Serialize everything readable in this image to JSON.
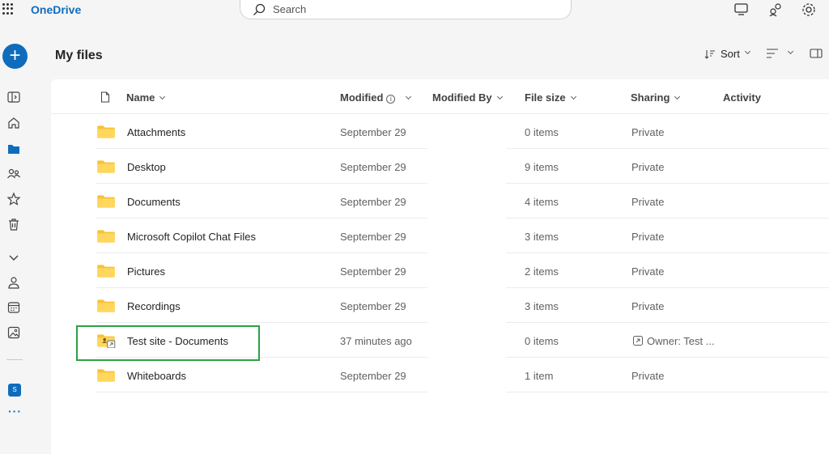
{
  "app": {
    "name": "OneDrive"
  },
  "search": {
    "placeholder": "Search"
  },
  "page": {
    "title": "My files"
  },
  "toolbar": {
    "sort_label": "Sort"
  },
  "new_button": {
    "label": "+"
  },
  "rail": {
    "site_badge": "S",
    "more": "···"
  },
  "columns": {
    "name": "Name",
    "modified": "Modified",
    "modified_info": "i",
    "modified_by": "Modified By",
    "file_size": "File size",
    "sharing": "Sharing",
    "activity": "Activity"
  },
  "files": [
    {
      "name": "Attachments",
      "modified": "September 29",
      "size": "0 items",
      "sharing": "Private"
    },
    {
      "name": "Desktop",
      "modified": "September 29",
      "size": "9 items",
      "sharing": "Private"
    },
    {
      "name": "Documents",
      "modified": "September 29",
      "size": "4 items",
      "sharing": "Private"
    },
    {
      "name": "Microsoft Copilot Chat Files",
      "modified": "September 29",
      "size": "3 items",
      "sharing": "Private"
    },
    {
      "name": "Pictures",
      "modified": "September 29",
      "size": "2 items",
      "sharing": "Private"
    },
    {
      "name": "Recordings",
      "modified": "September 29",
      "size": "3 items",
      "sharing": "Private"
    },
    {
      "name": "Test site - Documents",
      "modified": "37 minutes ago",
      "size": "0 items",
      "sharing": "Owner: Test ...",
      "shortcut": true
    },
    {
      "name": "Whiteboards",
      "modified": "September 29",
      "size": "1 item",
      "sharing": "Private"
    }
  ],
  "colors": {
    "accent": "#0f6cbd",
    "folder": "#f8c236",
    "highlight": "#2ea043"
  }
}
